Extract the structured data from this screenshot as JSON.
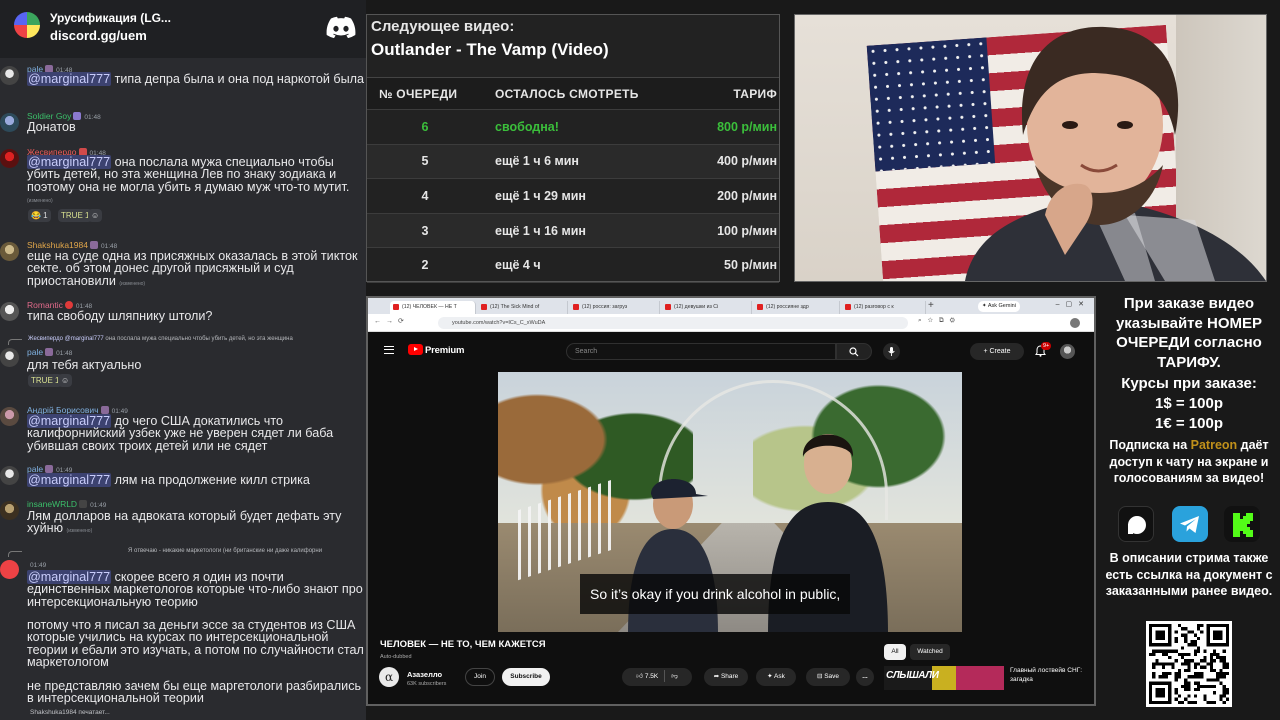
{
  "colors": {
    "chat_bg": "#2a2b2f",
    "mention_bg": "#3c4270",
    "free_slot": "#3bbf3b",
    "patreon_accent": "#c0901a",
    "youtube_red": "#ff0000"
  },
  "chat": {
    "server_name": "Урусификация (LG...",
    "invite": "discord.gg/uem",
    "messages": [
      {
        "user": "pale",
        "color": "#7fb0e0",
        "time": "01:48",
        "mention": "@marginal777",
        "text": " типа депра была и она под наркотой была"
      },
      {
        "user": "Soldier Goy",
        "color": "#3bbf6a",
        "time": "01:48",
        "mention": "",
        "text": "Донатов"
      },
      {
        "user": "Жесвипердо",
        "color": "#ed5a5a",
        "time": "01:48",
        "mention": "@marginal777",
        "text": " она послала мужа специально чтобы убить детей, но эта женщина Лев по знаку зодиака и поэтому она не могла убить я думаю муж что-то мутит.",
        "edited": "(изменено)",
        "reactions": [
          "😂 1",
          "TRUE 1",
          "☺"
        ]
      },
      {
        "user": "Shakshuka1984",
        "color": "#e0a64a",
        "time": "01:48",
        "mention": "",
        "text": "еще на суде одна из присяжных оказалась в этой тикток секте. об этом донес другой присяжный и суд приостановили",
        "edited": "(изменено)"
      },
      {
        "user": "Romantic",
        "color": "#e06a8a",
        "time": "01:48",
        "mention": "",
        "text": "типа свободу шляпнику штоли?"
      },
      {
        "user": "pale",
        "color": "#7fb0e0",
        "time": "01:48",
        "reply_name": "Жесвипердо",
        "reply_mention": "@marginal777",
        "reply_text": " она послала мужа специально чтобы убить детей, но эта женщина",
        "mention": "",
        "text": "для тебя актуально",
        "reactions": [
          "TRUE 1",
          "☺"
        ]
      },
      {
        "user": "Андрій Борисович",
        "color": "#7fb0e0",
        "time": "01:49",
        "mention": "@marginal777",
        "text": " до чего США докатились что калифорнийский узбек уже не уверен сядет ли баба убившая своих троих детей или не сядет"
      },
      {
        "user": "pale",
        "color": "#7fb0e0",
        "time": "01:49",
        "mention": "@marginal777",
        "text": " лям на продолжение килл стрика"
      },
      {
        "user": "insaneWRLD",
        "color": "#3bbf6a",
        "time": "01:49",
        "mention": "",
        "text": "Лям долларов на адвоката который будет дефать эту хуйню",
        "edited": "(изменено)"
      },
      {
        "user": "",
        "color": "#ed4245",
        "time": "01:49",
        "reply_name": "",
        "reply_mention": "",
        "reply_text": "Я отвечаю - никакие маркетологи (ни британские ни даже калифорни",
        "mention": "@marginal777",
        "text": " скорее всего я один из почти единственных маркетологов которые что-либо знают про интерсекциональную теорию"
      },
      {
        "user": "",
        "color": "",
        "time": "",
        "mention": "",
        "text": "потому что я писал  за деньги эссе за студентов из США которые учились на курсах по интерсекциональной теории и ебали это изучать, а потом по случайности стал маркетологом"
      },
      {
        "user": "",
        "color": "",
        "time": "",
        "mention": "",
        "text": "не представляю зачем бы еще маргетологи разбирались в интерсекциональной теории"
      }
    ],
    "typing": "Shakshuka1984 печатает..."
  },
  "queue": {
    "next_label": "Следующее видео:",
    "next_title": "Outlander - The Vamp (Video)",
    "headers": [
      "№ ОЧЕРЕДИ",
      "ОСТАЛОСЬ СМОТРЕТЬ",
      "ТАРИФ"
    ],
    "rows": [
      {
        "num": "6",
        "remaining": "свободна!",
        "rate": "800 р/мин",
        "free": true
      },
      {
        "num": "5",
        "remaining": "ещё 1 ч 6 мин",
        "rate": "400 р/мин"
      },
      {
        "num": "4",
        "remaining": "ещё 1 ч 29 мин",
        "rate": "200 р/мин"
      },
      {
        "num": "3",
        "remaining": "ещё 1 ч 16 мин",
        "rate": "100 р/мин"
      },
      {
        "num": "2",
        "remaining": "ещё 4 ч",
        "rate": "50 р/мин"
      }
    ]
  },
  "browser": {
    "tabs": [
      {
        "label": "(12) ЧЕЛОВЕК — НЕ Т",
        "active": true
      },
      {
        "label": "(12) The Sick Mind of"
      },
      {
        "label": "(12) россия: загруз"
      },
      {
        "label": "(12) девушки из Сі"
      },
      {
        "label": "(12) россияне здр"
      },
      {
        "label": "(12) разговор с к"
      }
    ],
    "new_tab": "+",
    "gemini": "✦ Ask Gemini",
    "url": "youtube.com/watch?v=ICs_C_xWuDA"
  },
  "youtube": {
    "brand": "Premium",
    "search_placeholder": "Search",
    "create_label": "+ Create",
    "notif_count": "9+",
    "subtitle": "So it’s okay if you drink alcohol in public,",
    "video_title": "ЧЕЛОВЕК — НЕ ТО, ЧЕМ КАЖЕТСЯ",
    "auto_dubbed": "Auto-dubbed",
    "channel_logo": "α",
    "channel_name": "Азазелло",
    "channel_subs": "63K subscribers",
    "join_label": "Join",
    "subscribe_label": "Subscribe",
    "likes": "7.5K",
    "share_label": "Share",
    "ask_label": "Ask",
    "save_label": "Save",
    "more_label": "...",
    "filters": [
      "All",
      "Watched"
    ],
    "rec_thumb_text": "СЛЫШАЛИ",
    "rec_title": "Главный лоствейв СНГ: загадка"
  },
  "info": {
    "order_note": "При заказе видео указывайте НОМЕР ОЧЕРЕДИ согласно ТАРИФУ.",
    "rates_title": "Курсы при заказе:",
    "rate_usd": "1$ = 100р",
    "rate_eur": "1€ = 100р",
    "patreon_pre": "Подписка на ",
    "patreon_word": "Patreon",
    "patreon_post": " даёт доступ к чату на экране и голосованиям за видео!",
    "docs_note": "В описании стрима также есть ссылка на документ с заказанными ранее видео.",
    "icons": [
      "patreon-icon",
      "telegram-icon",
      "kick-icon"
    ]
  }
}
